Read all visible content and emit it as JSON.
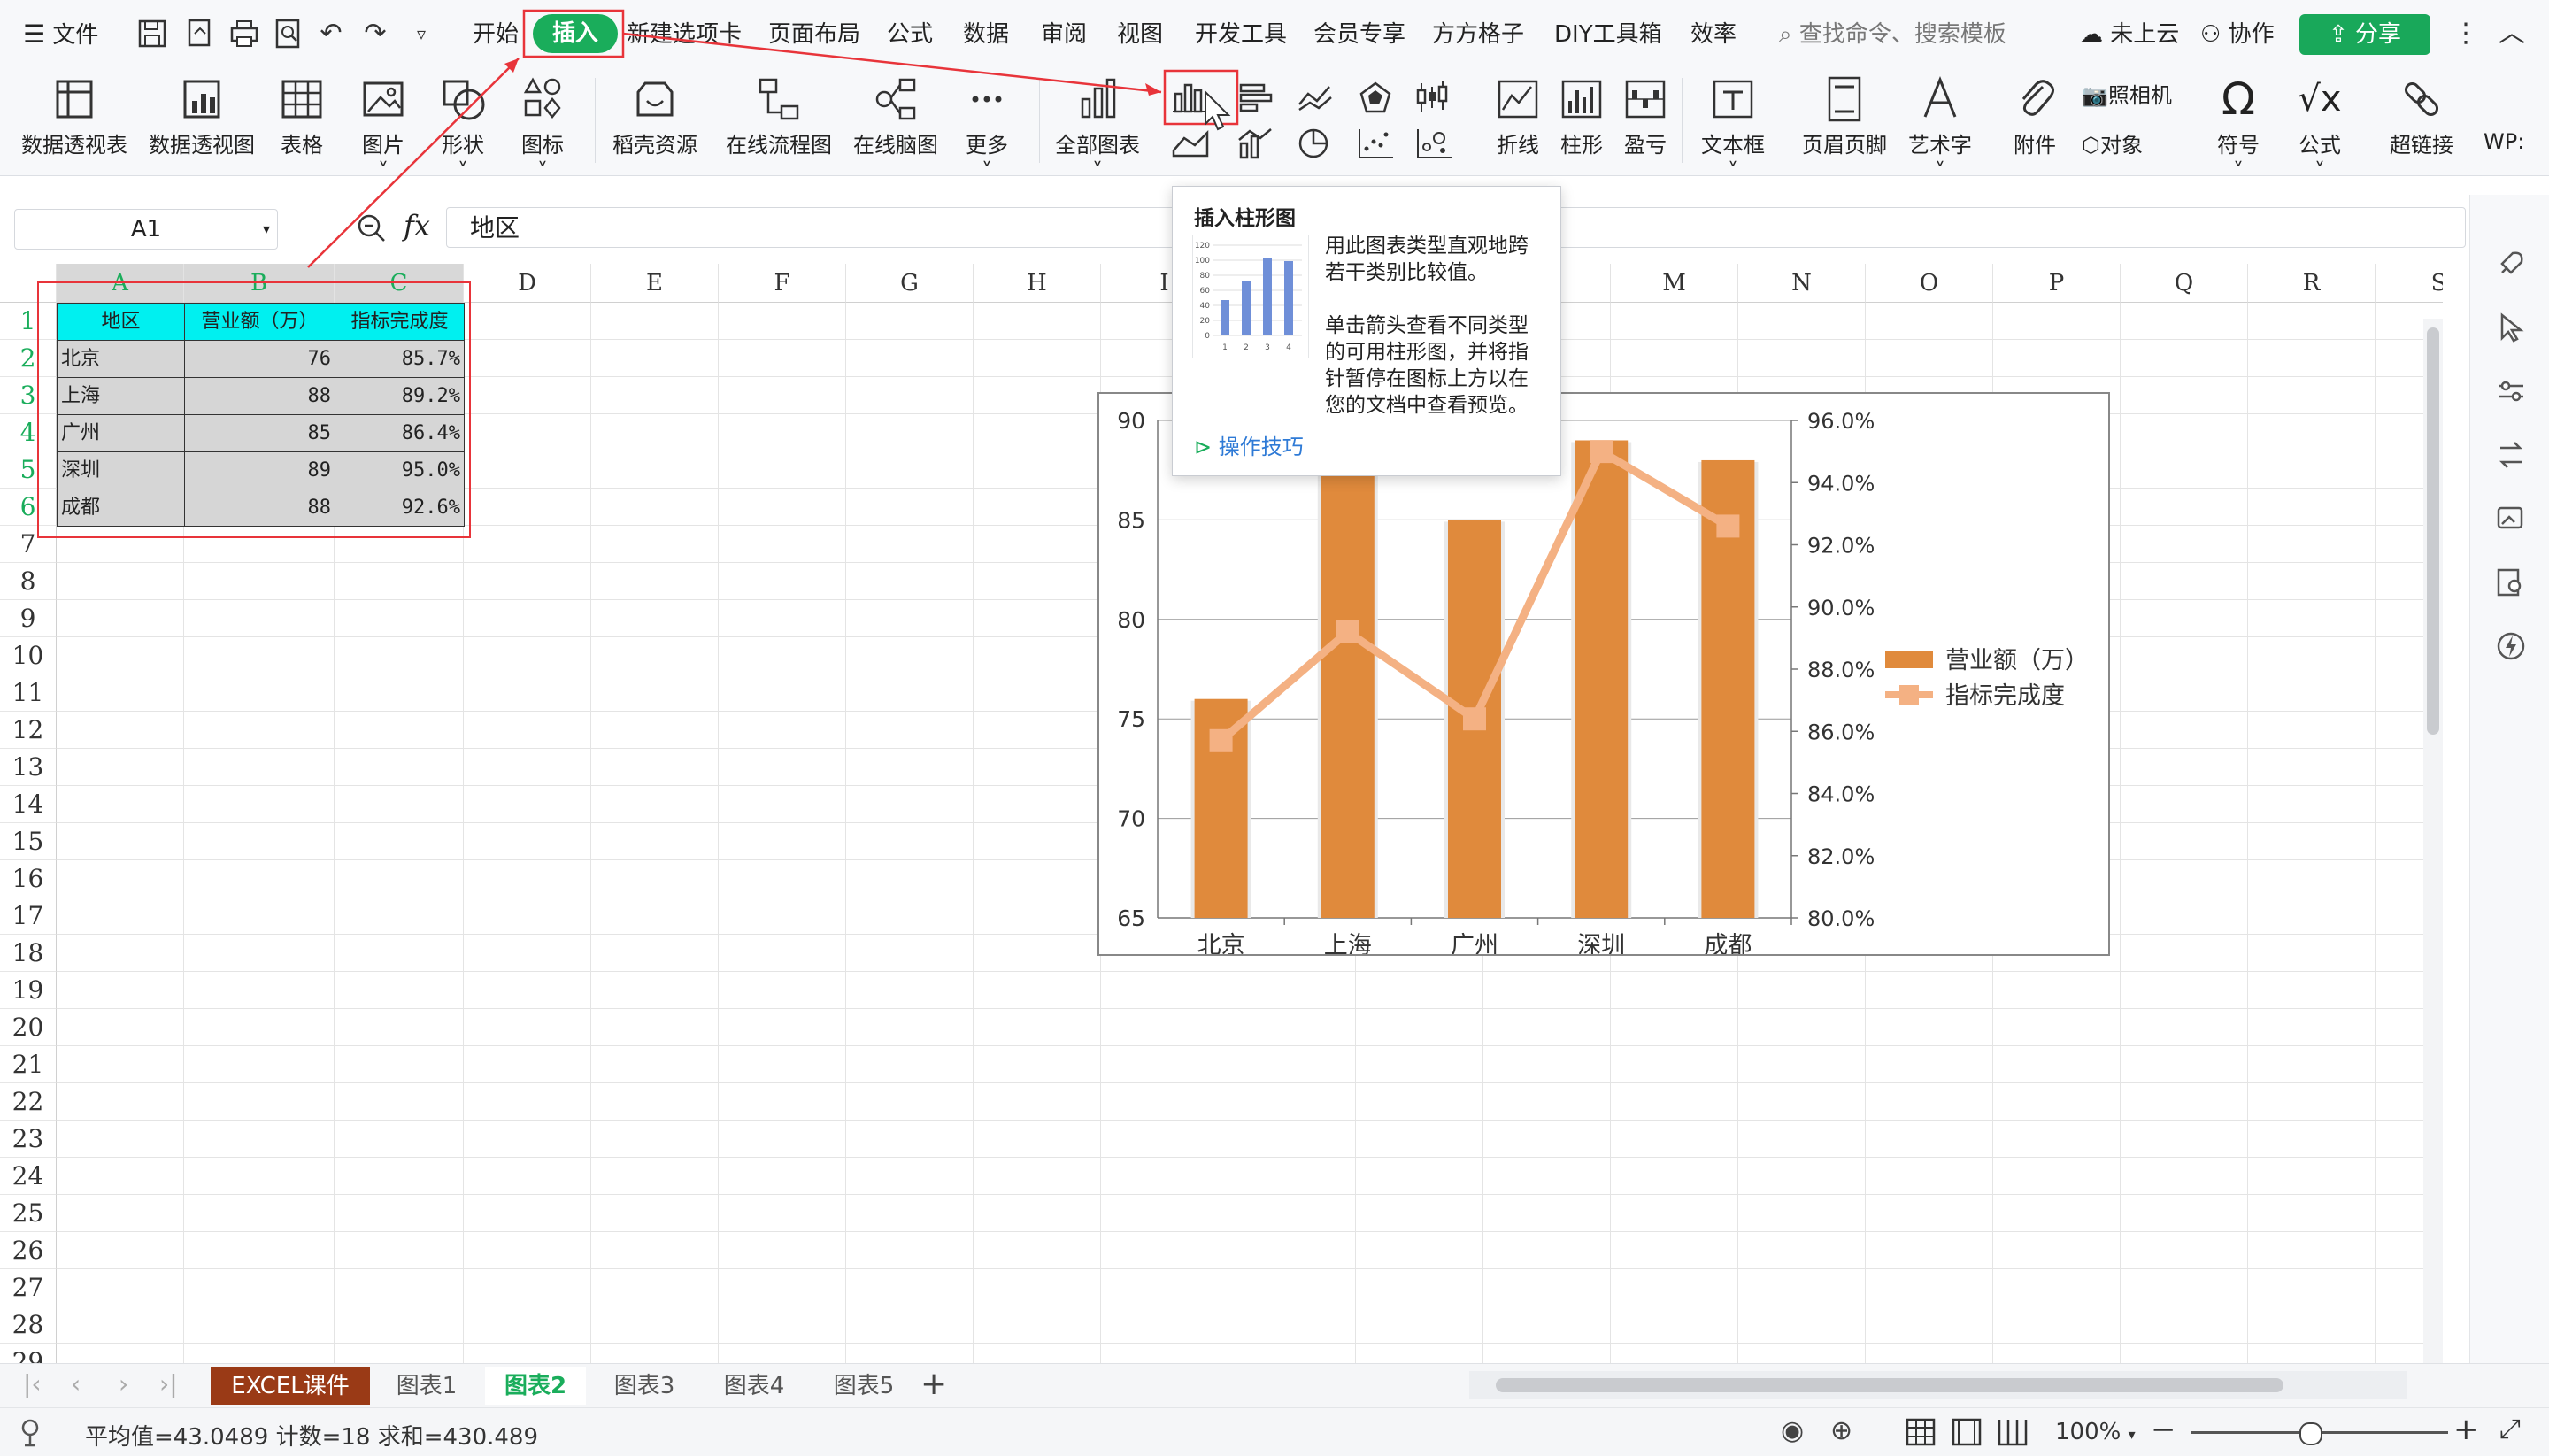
{
  "menubar": {
    "file_label": "文件",
    "tabs": [
      "开始",
      "插入",
      "新建选项卡",
      "页面布局",
      "公式",
      "数据",
      "审阅",
      "视图",
      "开发工具",
      "会员专享",
      "方方格子",
      "DIY工具箱",
      "效率"
    ],
    "search_placeholder": "查找命令、搜索模板",
    "cloud_label": "未上云",
    "collab_label": "协作",
    "share_label": "分享"
  },
  "ribbon": {
    "pivot_table": "数据透视表",
    "pivot_chart": "数据透视图",
    "table": "表格",
    "picture": "图片",
    "shape": "形状",
    "icon": "图标",
    "docer": "稻壳资源",
    "flowchart": "在线流程图",
    "mindmap": "在线脑图",
    "more": "更多",
    "all_charts": "全部图表",
    "line": "折线",
    "column": "柱形",
    "winloss": "盈亏",
    "textbox": "文本框",
    "header_footer": "页眉页脚",
    "wordart": "艺术字",
    "attachment": "附件",
    "camera": "照相机",
    "object": "对象",
    "symbol": "符号",
    "formula": "公式",
    "hyperlink": "超链接",
    "wps": "WP:"
  },
  "formula_bar": {
    "cell_ref": "A1",
    "fx": "fx",
    "content": "地区"
  },
  "columns": [
    "A",
    "B",
    "C",
    "D",
    "E",
    "F",
    "G",
    "H",
    "I",
    "J",
    "K",
    "L",
    "M",
    "N",
    "O",
    "P",
    "Q",
    "R",
    "S"
  ],
  "rows": [
    "1",
    "2",
    "3",
    "4",
    "5",
    "6",
    "7",
    "8",
    "9",
    "10",
    "11",
    "12",
    "13",
    "14",
    "15",
    "16",
    "17",
    "18",
    "19",
    "20",
    "21",
    "22",
    "23",
    "24",
    "25",
    "26",
    "27",
    "28",
    "29"
  ],
  "table": {
    "headers": [
      "地区",
      "营业额（万）",
      "指标完成度"
    ],
    "rows": [
      [
        "北京",
        "76",
        "85.7%"
      ],
      [
        "上海",
        "88",
        "89.2%"
      ],
      [
        "广州",
        "85",
        "86.4%"
      ],
      [
        "深圳",
        "89",
        "95.0%"
      ],
      [
        "成都",
        "88",
        "92.6%"
      ]
    ]
  },
  "tooltip": {
    "title": "插入柱形图",
    "line1": "用此图表类型直观地跨若干类别比较值。",
    "line2": "单击箭头查看不同类型的可用柱形图，并将指针暂停在图标上方以在您的文档中查看预览。",
    "link": "操作技巧",
    "preview_ticks": [
      "120",
      "100",
      "80",
      "60",
      "40",
      "20",
      "0"
    ],
    "preview_cats": [
      "1",
      "2",
      "3",
      "4"
    ]
  },
  "chart_data": {
    "type": "bar",
    "categories": [
      "北京",
      "上海",
      "广州",
      "深圳",
      "成都"
    ],
    "series": [
      {
        "name": "营业额（万）",
        "type": "bar",
        "axis": "left",
        "values": [
          76,
          88,
          85,
          89,
          88
        ],
        "color": "#e08a3c"
      },
      {
        "name": "指标完成度",
        "type": "line",
        "axis": "right",
        "values": [
          85.7,
          89.2,
          86.4,
          95.0,
          92.6
        ],
        "color": "#f4b183"
      }
    ],
    "ylim": [
      65,
      90
    ],
    "y_ticks": [
      "90",
      "85",
      "80",
      "75",
      "70",
      "65"
    ],
    "y2lim": [
      80,
      96
    ],
    "y2_ticks": [
      "96.0%",
      "94.0%",
      "92.0%",
      "90.0%",
      "88.0%",
      "86.0%",
      "84.0%",
      "82.0%",
      "80.0%"
    ],
    "grid": true,
    "legend": "right"
  },
  "sheets": {
    "tabs": [
      "EXCEL课件",
      "图表1",
      "图表2",
      "图表3",
      "图表4",
      "图表5"
    ],
    "active": "图表2"
  },
  "status": {
    "summary": "平均值=43.0489  计数=18  求和=430.489",
    "zoom": "100%"
  },
  "colors": {
    "accent": "#1aad5b",
    "header_fill": "#00f0f0",
    "data_fill": "#d6d6d6",
    "highlight": "#e8343a",
    "bar": "#e08a3c",
    "line": "#f4b183",
    "sheet_tab_active_fill": "#9a3a16"
  }
}
